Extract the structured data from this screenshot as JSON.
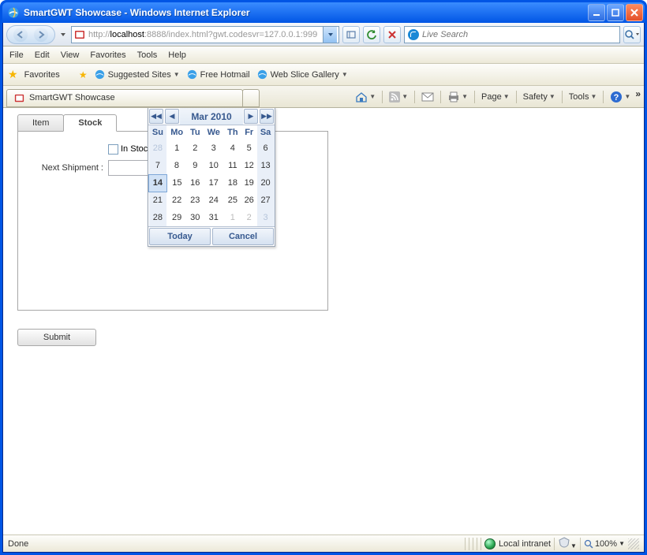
{
  "window": {
    "title": "SmartGWT Showcase - Windows Internet Explorer"
  },
  "address": {
    "prefix": "http://",
    "host": "localhost",
    "rest": ":8888/index.html?gwt.codesvr=127.0.0.1:999"
  },
  "search": {
    "placeholder": "Live Search"
  },
  "menu": {
    "file": "File",
    "edit": "Edit",
    "view": "View",
    "favorites": "Favorites",
    "tools": "Tools",
    "help": "Help"
  },
  "favbar": {
    "label": "Favorites",
    "suggested": "Suggested Sites",
    "hotmail": "Free Hotmail",
    "webslice": "Web Slice Gallery"
  },
  "tab": {
    "title": "SmartGWT Showcase"
  },
  "toolbar": {
    "page": "Page",
    "safety": "Safety",
    "tools": "Tools"
  },
  "form": {
    "tabs": {
      "item": "Item",
      "stock": "Stock"
    },
    "in_stock": "In Stock",
    "next_shipment": "Next Shipment :",
    "submit": "Submit"
  },
  "calendar": {
    "title": "Mar 2010",
    "dow": [
      "Su",
      "Mo",
      "Tu",
      "We",
      "Th",
      "Fr",
      "Sa"
    ],
    "today_label": "Today",
    "cancel_label": "Cancel",
    "weeks": [
      [
        {
          "d": "28",
          "dim": true
        },
        {
          "d": "1"
        },
        {
          "d": "2"
        },
        {
          "d": "3"
        },
        {
          "d": "4"
        },
        {
          "d": "5"
        },
        {
          "d": "6"
        }
      ],
      [
        {
          "d": "7"
        },
        {
          "d": "8"
        },
        {
          "d": "9"
        },
        {
          "d": "10"
        },
        {
          "d": "11"
        },
        {
          "d": "12"
        },
        {
          "d": "13"
        }
      ],
      [
        {
          "d": "14",
          "today": true
        },
        {
          "d": "15"
        },
        {
          "d": "16"
        },
        {
          "d": "17"
        },
        {
          "d": "18"
        },
        {
          "d": "19"
        },
        {
          "d": "20"
        }
      ],
      [
        {
          "d": "21"
        },
        {
          "d": "22"
        },
        {
          "d": "23"
        },
        {
          "d": "24"
        },
        {
          "d": "25"
        },
        {
          "d": "26"
        },
        {
          "d": "27"
        }
      ],
      [
        {
          "d": "28"
        },
        {
          "d": "29"
        },
        {
          "d": "30"
        },
        {
          "d": "31"
        },
        {
          "d": "1",
          "dim": true
        },
        {
          "d": "2",
          "dim": true
        },
        {
          "d": "3",
          "dim": true
        }
      ]
    ]
  },
  "status": {
    "done": "Done",
    "zone": "Local intranet",
    "zoom": "100%"
  }
}
